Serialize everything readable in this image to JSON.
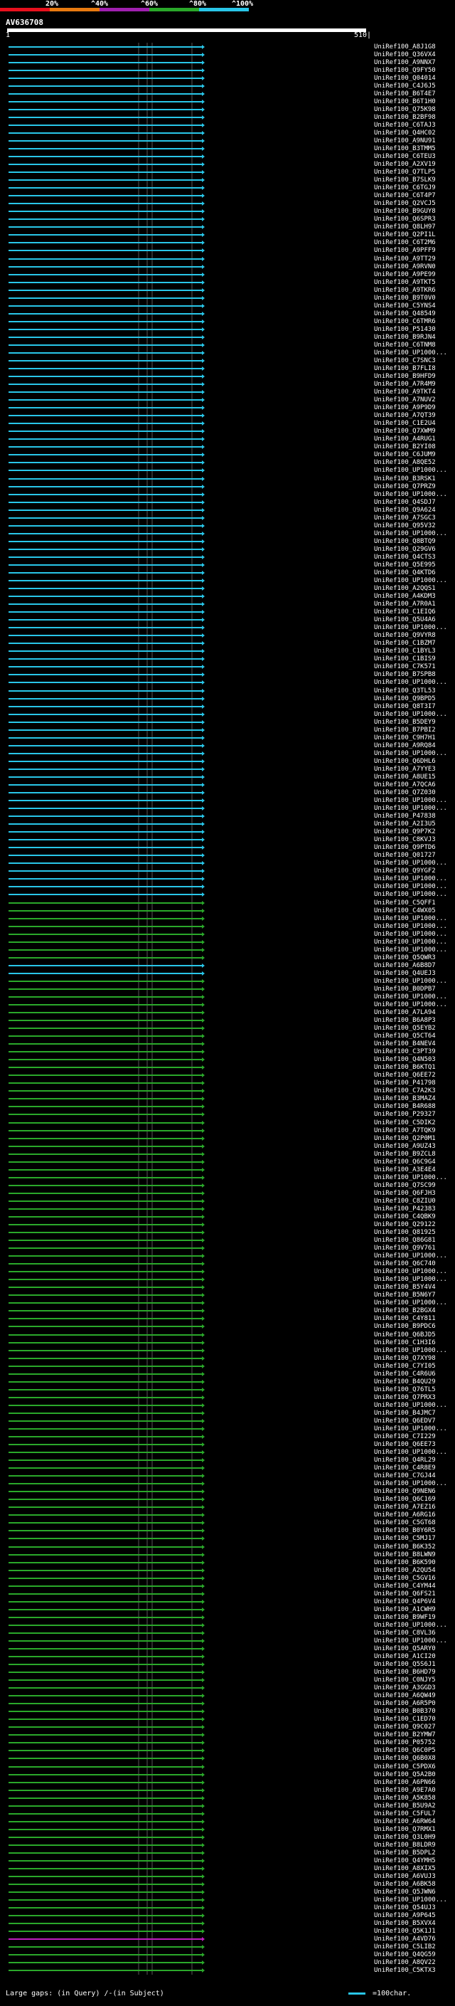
{
  "legend": {
    "ticks": [
      "20%",
      "^40%",
      "^60%",
      "^80%",
      "^100%"
    ],
    "colors": [
      "#e8101d",
      "#e87a10",
      "#a020b0",
      "#2aa82a",
      "#29c6e8"
    ]
  },
  "query": {
    "title": "AV636708",
    "start": "1",
    "end": "510|"
  },
  "colors": {
    "cyan": "#29c6e8",
    "green": "#2aa82a",
    "magenta": "#c020c0",
    "background": "#000000",
    "query_bar": "#ffffff"
  },
  "hits": [
    {
      "label": "UniRef100_A8J1G8",
      "color": "cyan"
    },
    {
      "label": "UniRef100_Q36VX4",
      "color": "cyan"
    },
    {
      "label": "UniRef100_A9NNX7",
      "color": "cyan"
    },
    {
      "label": "UniRef100_Q9FY50",
      "color": "cyan"
    },
    {
      "label": "UniRef100_Q04014",
      "color": "cyan"
    },
    {
      "label": "UniRef100_C4J6J5",
      "color": "cyan"
    },
    {
      "label": "UniRef100_B6T4E7",
      "color": "cyan"
    },
    {
      "label": "UniRef100_B6T1H0",
      "color": "cyan"
    },
    {
      "label": "UniRef100_Q75K98",
      "color": "cyan"
    },
    {
      "label": "UniRef100_B2BF98",
      "color": "cyan"
    },
    {
      "label": "UniRef100_C6TAJ3",
      "color": "cyan"
    },
    {
      "label": "UniRef100_Q4HC02",
      "color": "cyan"
    },
    {
      "label": "UniRef100_A9NU91",
      "color": "cyan"
    },
    {
      "label": "UniRef100_B3TMM5",
      "color": "cyan"
    },
    {
      "label": "UniRef100_C6TEU3",
      "color": "cyan"
    },
    {
      "label": "UniRef100_A2XV19",
      "color": "cyan"
    },
    {
      "label": "UniRef100_Q7TLP5",
      "color": "cyan"
    },
    {
      "label": "UniRef100_B7SLK9",
      "color": "cyan"
    },
    {
      "label": "UniRef100_C6TGJ9",
      "color": "cyan"
    },
    {
      "label": "UniRef100_C6T4P7",
      "color": "cyan"
    },
    {
      "label": "UniRef100_Q2VCJ5",
      "color": "cyan"
    },
    {
      "label": "UniRef100_B9GUY8",
      "color": "cyan"
    },
    {
      "label": "UniRef100_Q6SPR3",
      "color": "cyan"
    },
    {
      "label": "UniRef100_Q8LH97",
      "color": "cyan"
    },
    {
      "label": "UniRef100_Q2PI1L",
      "color": "cyan"
    },
    {
      "label": "UniRef100_C6T2M6",
      "color": "cyan"
    },
    {
      "label": "UniRef100_A9PFF9",
      "color": "cyan"
    },
    {
      "label": "UniRef100_A9TT29",
      "color": "cyan"
    },
    {
      "label": "UniRef100_A9RVN0",
      "color": "cyan"
    },
    {
      "label": "UniRef100_A9PE99",
      "color": "cyan"
    },
    {
      "label": "UniRef100_A9TKT5",
      "color": "cyan"
    },
    {
      "label": "UniRef100_A9TKR6",
      "color": "cyan"
    },
    {
      "label": "UniRef100_B9T0V0",
      "color": "cyan"
    },
    {
      "label": "UniRef100_C5YNS4",
      "color": "cyan"
    },
    {
      "label": "UniRef100_Q48549",
      "color": "cyan"
    },
    {
      "label": "UniRef100_C6TMR6",
      "color": "cyan"
    },
    {
      "label": "UniRef100_P51430",
      "color": "cyan"
    },
    {
      "label": "UniRef100_B9RJN4",
      "color": "cyan"
    },
    {
      "label": "UniRef100_C6TNM8",
      "color": "cyan"
    },
    {
      "label": "UniRef100_UP1000...",
      "color": "cyan"
    },
    {
      "label": "UniRef100_C7SNC3",
      "color": "cyan"
    },
    {
      "label": "UniRef100_B7FLI8",
      "color": "cyan"
    },
    {
      "label": "UniRef100_B9HFD9",
      "color": "cyan"
    },
    {
      "label": "UniRef100_A7R4M9",
      "color": "cyan"
    },
    {
      "label": "UniRef100_A9TKT4",
      "color": "cyan"
    },
    {
      "label": "UniRef100_A7NUV2",
      "color": "cyan"
    },
    {
      "label": "UniRef100_A9P9D9",
      "color": "cyan"
    },
    {
      "label": "UniRef100_A7QT39",
      "color": "cyan"
    },
    {
      "label": "UniRef100_C1E2U4",
      "color": "cyan"
    },
    {
      "label": "UniRef100_Q7XWM9",
      "color": "cyan"
    },
    {
      "label": "UniRef100_A4RUG1",
      "color": "cyan"
    },
    {
      "label": "UniRef100_B2YI08",
      "color": "cyan"
    },
    {
      "label": "UniRef100_C6JUM9",
      "color": "cyan"
    },
    {
      "label": "UniRef100_A8QE52",
      "color": "cyan"
    },
    {
      "label": "UniRef100_UP1000...",
      "color": "cyan"
    },
    {
      "label": "UniRef100_B3RSK1",
      "color": "cyan"
    },
    {
      "label": "UniRef100_Q7PRZ9",
      "color": "cyan"
    },
    {
      "label": "UniRef100_UP1000...",
      "color": "cyan"
    },
    {
      "label": "UniRef100_Q4SDJ7",
      "color": "cyan"
    },
    {
      "label": "UniRef100_Q9A624",
      "color": "cyan"
    },
    {
      "label": "UniRef100_A7SGC3",
      "color": "cyan"
    },
    {
      "label": "UniRef100_Q95V32",
      "color": "cyan"
    },
    {
      "label": "UniRef100_UP1000...",
      "color": "cyan"
    },
    {
      "label": "UniRef100_Q8BTQ9",
      "color": "cyan"
    },
    {
      "label": "UniRef100_Q29GV6",
      "color": "cyan"
    },
    {
      "label": "UniRef100_Q4CTS3",
      "color": "cyan"
    },
    {
      "label": "UniRef100_Q5E995",
      "color": "cyan"
    },
    {
      "label": "UniRef100_Q4KTD6",
      "color": "cyan"
    },
    {
      "label": "UniRef100_UP1000...",
      "color": "cyan"
    },
    {
      "label": "UniRef100_A2QQS1",
      "color": "cyan"
    },
    {
      "label": "UniRef100_A4KDM3",
      "color": "cyan"
    },
    {
      "label": "UniRef100_A7R0A1",
      "color": "cyan"
    },
    {
      "label": "UniRef100_C1EIQ6",
      "color": "cyan"
    },
    {
      "label": "UniRef100_Q5U4A6",
      "color": "cyan"
    },
    {
      "label": "UniRef100_UP1000...",
      "color": "cyan"
    },
    {
      "label": "UniRef100_Q9VYR8",
      "color": "cyan"
    },
    {
      "label": "UniRef100_C1BZM7",
      "color": "cyan"
    },
    {
      "label": "UniRef100_C1BYL3",
      "color": "cyan"
    },
    {
      "label": "UniRef100_C1BIS9",
      "color": "cyan"
    },
    {
      "label": "UniRef100_C7K571",
      "color": "cyan"
    },
    {
      "label": "UniRef100_B7SPB8",
      "color": "cyan"
    },
    {
      "label": "UniRef100_UP1000...",
      "color": "cyan"
    },
    {
      "label": "UniRef100_Q3TL53",
      "color": "cyan"
    },
    {
      "label": "UniRef100_Q9BPD5",
      "color": "cyan"
    },
    {
      "label": "UniRef100_Q8T3I7",
      "color": "cyan"
    },
    {
      "label": "UniRef100_UP1000...",
      "color": "cyan"
    },
    {
      "label": "UniRef100_B5DEY9",
      "color": "cyan"
    },
    {
      "label": "UniRef100_B7PBI2",
      "color": "cyan"
    },
    {
      "label": "UniRef100_C9H7H1",
      "color": "cyan"
    },
    {
      "label": "UniRef100_A9RQ84",
      "color": "cyan"
    },
    {
      "label": "UniRef100_UP1000...",
      "color": "cyan"
    },
    {
      "label": "UniRef100_Q6DHL6",
      "color": "cyan"
    },
    {
      "label": "UniRef100_A7YYE3",
      "color": "cyan"
    },
    {
      "label": "UniRef100_A8UE15",
      "color": "cyan"
    },
    {
      "label": "UniRef100_A7QCA6",
      "color": "cyan"
    },
    {
      "label": "UniRef100_Q7Z030",
      "color": "cyan"
    },
    {
      "label": "UniRef100_UP1000...",
      "color": "cyan"
    },
    {
      "label": "UniRef100_UP1000...",
      "color": "cyan"
    },
    {
      "label": "UniRef100_P47838",
      "color": "cyan"
    },
    {
      "label": "UniRef100_A2I3U5",
      "color": "cyan"
    },
    {
      "label": "UniRef100_Q9P7K2",
      "color": "cyan"
    },
    {
      "label": "UniRef100_C8KVJ3",
      "color": "cyan"
    },
    {
      "label": "UniRef100_Q9PTD6",
      "color": "cyan"
    },
    {
      "label": "UniRef100_Q01727",
      "color": "cyan"
    },
    {
      "label": "UniRef100_UP1000...",
      "color": "cyan"
    },
    {
      "label": "UniRef100_Q9YGF2",
      "color": "cyan"
    },
    {
      "label": "UniRef100_UP1000...",
      "color": "cyan"
    },
    {
      "label": "UniRef100_UP1000...",
      "color": "cyan"
    },
    {
      "label": "UniRef100_UP1000...",
      "color": "cyan"
    },
    {
      "label": "UniRef100_C5QFF1",
      "color": "green"
    },
    {
      "label": "UniRef100_C4WX05",
      "color": "green"
    },
    {
      "label": "UniRef100_UP1000...",
      "color": "green"
    },
    {
      "label": "UniRef100_UP1000...",
      "color": "green"
    },
    {
      "label": "UniRef100_UP1000...",
      "color": "green"
    },
    {
      "label": "UniRef100_UP1000...",
      "color": "green"
    },
    {
      "label": "UniRef100_UP1000...",
      "color": "green"
    },
    {
      "label": "UniRef100_Q5QWR3",
      "color": "green"
    },
    {
      "label": "UniRef100_A6B8D7",
      "color": "cyan"
    },
    {
      "label": "UniRef100_Q4UEJ3",
      "color": "cyan"
    },
    {
      "label": "UniRef100_UP1000...",
      "color": "green"
    },
    {
      "label": "UniRef100_B0DPB7",
      "color": "green"
    },
    {
      "label": "UniRef100_UP1000...",
      "color": "green"
    },
    {
      "label": "UniRef100_UP1000...",
      "color": "green"
    },
    {
      "label": "UniRef100_A7LA94",
      "color": "green"
    },
    {
      "label": "UniRef100_B6A8P3",
      "color": "green"
    },
    {
      "label": "UniRef100_Q5EYB2",
      "color": "green"
    },
    {
      "label": "UniRef100_Q5CT64",
      "color": "green"
    },
    {
      "label": "UniRef100_B4NEV4",
      "color": "green"
    },
    {
      "label": "UniRef100_C3PT39",
      "color": "green"
    },
    {
      "label": "UniRef100_Q4N503",
      "color": "green"
    },
    {
      "label": "UniRef100_B6KTQ1",
      "color": "green"
    },
    {
      "label": "UniRef100_Q6EE72",
      "color": "green"
    },
    {
      "label": "UniRef100_P41798",
      "color": "green"
    },
    {
      "label": "UniRef100_C7A2K3",
      "color": "green"
    },
    {
      "label": "UniRef100_B3MAZ4",
      "color": "green"
    },
    {
      "label": "UniRef100_B4R688",
      "color": "green"
    },
    {
      "label": "UniRef100_P29327",
      "green": true,
      "color": "green"
    },
    {
      "label": "UniRef100_C5DIK2",
      "color": "green"
    },
    {
      "label": "UniRef100_A7TQK9",
      "color": "green"
    },
    {
      "label": "UniRef100_Q2P0M1",
      "color": "green"
    },
    {
      "label": "UniRef100_A9UZ43",
      "color": "green"
    },
    {
      "label": "UniRef100_B9ZCL8",
      "color": "green"
    },
    {
      "label": "UniRef100_Q6C9G4",
      "color": "green"
    },
    {
      "label": "UniRef100_A3E4E4",
      "color": "green"
    },
    {
      "label": "UniRef100_UP1000...",
      "color": "green"
    },
    {
      "label": "UniRef100_Q7SC99",
      "color": "green"
    },
    {
      "label": "UniRef100_Q6FJH3",
      "color": "green"
    },
    {
      "label": "UniRef100_C8ZIU0",
      "color": "green"
    },
    {
      "label": "UniRef100_P42383",
      "color": "green"
    },
    {
      "label": "UniRef100_C4QBK9",
      "color": "green"
    },
    {
      "label": "UniRef100_Q29122",
      "color": "green"
    },
    {
      "label": "UniRef100_Q81925",
      "color": "green"
    },
    {
      "label": "UniRef100_Q86G81",
      "color": "green"
    },
    {
      "label": "UniRef100_Q9V761",
      "color": "green"
    },
    {
      "label": "UniRef100_UP1000...",
      "color": "green"
    },
    {
      "label": "UniRef100_Q6C740",
      "color": "green"
    },
    {
      "label": "UniRef100_UP1000...",
      "color": "green"
    },
    {
      "label": "UniRef100_UP1000...",
      "color": "green"
    },
    {
      "label": "UniRef100_B5Y4V4",
      "color": "green"
    },
    {
      "label": "UniRef100_B5N6Y7",
      "color": "green"
    },
    {
      "label": "UniRef100_UP1000...",
      "color": "green"
    },
    {
      "label": "UniRef100_B2BGX4",
      "color": "green"
    },
    {
      "label": "UniRef100_C4Y811",
      "color": "green"
    },
    {
      "label": "UniRef100_B9PDC6",
      "color": "green"
    },
    {
      "label": "UniRef100_Q6BJD5",
      "color": "green"
    },
    {
      "label": "UniRef100_C1H3I6",
      "color": "green"
    },
    {
      "label": "UniRef100_UP1000...",
      "color": "green"
    },
    {
      "label": "UniRef100_Q7XY98",
      "color": "green"
    },
    {
      "label": "UniRef100_C7YI05",
      "color": "green"
    },
    {
      "label": "UniRef100_C4R6U6",
      "color": "green"
    },
    {
      "label": "UniRef100_B4QU29",
      "color": "green"
    },
    {
      "label": "UniRef100_Q76TL5",
      "color": "green"
    },
    {
      "label": "UniRef100_Q7PRX3",
      "color": "green"
    },
    {
      "label": "UniRef100_UP1000...",
      "color": "green"
    },
    {
      "label": "UniRef100_B4JMC7",
      "color": "green"
    },
    {
      "label": "UniRef100_Q6EDV7",
      "color": "green"
    },
    {
      "label": "UniRef100_UP1000...",
      "color": "green"
    },
    {
      "label": "UniRef100_C7I229",
      "color": "green"
    },
    {
      "label": "UniRef100_Q6EE73",
      "color": "green"
    },
    {
      "label": "UniRef100_UP1000...",
      "color": "green"
    },
    {
      "label": "UniRef100_Q4RL29",
      "color": "green"
    },
    {
      "label": "UniRef100_C4R8E9",
      "color": "green"
    },
    {
      "label": "UniRef100_C7GJ44",
      "color": "green"
    },
    {
      "label": "UniRef100_UP1000...",
      "color": "green"
    },
    {
      "label": "UniRef100_Q9NEN6",
      "color": "green"
    },
    {
      "label": "UniRef100_Q6C169",
      "color": "green"
    },
    {
      "label": "UniRef100_A7EZ16",
      "color": "green"
    },
    {
      "label": "UniRef100_A6RG16",
      "color": "green"
    },
    {
      "label": "UniRef100_C5GT68",
      "color": "green"
    },
    {
      "label": "UniRef100_B0Y6R5",
      "color": "green"
    },
    {
      "label": "UniRef100_C5MJ17",
      "color": "green"
    },
    {
      "label": "UniRef100_B6K352",
      "color": "green"
    },
    {
      "label": "UniRef100_B8LWN9",
      "color": "green"
    },
    {
      "label": "UniRef100_B6K590",
      "color": "green"
    },
    {
      "label": "UniRef100_A2QU54",
      "color": "green"
    },
    {
      "label": "UniRef100_C5GV16",
      "color": "green"
    },
    {
      "label": "UniRef100_C4YM44",
      "color": "green"
    },
    {
      "label": "UniRef100_Q6FS21",
      "color": "green"
    },
    {
      "label": "UniRef100_Q4P6V4",
      "color": "green"
    },
    {
      "label": "UniRef100_A1CWH9",
      "color": "green"
    },
    {
      "label": "UniRef100_B9WF19",
      "color": "green"
    },
    {
      "label": "UniRef100_UP1000...",
      "color": "green"
    },
    {
      "label": "UniRef100_C8VL36",
      "color": "green"
    },
    {
      "label": "UniRef100_UP1000...",
      "color": "green"
    },
    {
      "label": "UniRef100_Q5ARY0",
      "color": "green"
    },
    {
      "label": "UniRef100_A1CI20",
      "color": "green"
    },
    {
      "label": "UniRef100_Q5S6J1",
      "color": "green"
    },
    {
      "label": "UniRef100_B6HD79",
      "color": "green"
    },
    {
      "label": "UniRef100_C0NJY5",
      "color": "green"
    },
    {
      "label": "UniRef100_A3GGD3",
      "color": "green"
    },
    {
      "label": "UniRef100_A6QW49",
      "color": "green"
    },
    {
      "label": "UniRef100_A6R5P0",
      "color": "green"
    },
    {
      "label": "UniRef100_B0B370",
      "color": "green"
    },
    {
      "label": "UniRef100_C1ED70",
      "color": "green"
    },
    {
      "label": "UniRef100_Q9C027",
      "color": "green"
    },
    {
      "label": "UniRef100_B2YMW7",
      "color": "green"
    },
    {
      "label": "UniRef100_P05752",
      "color": "green"
    },
    {
      "label": "UniRef100_Q6C0P5",
      "color": "green"
    },
    {
      "label": "UniRef100_Q6B0X8",
      "color": "green"
    },
    {
      "label": "UniRef100_C5PDX6",
      "color": "green"
    },
    {
      "label": "UniRef100_Q5A2B0",
      "color": "green"
    },
    {
      "label": "UniRef100_A6PN66",
      "color": "green"
    },
    {
      "label": "UniRef100_A9E7A0",
      "color": "green"
    },
    {
      "label": "UniRef100_A5K858",
      "color": "green"
    },
    {
      "label": "UniRef100_B5U9A2",
      "color": "green"
    },
    {
      "label": "UniRef100_C5FUL7",
      "color": "green"
    },
    {
      "label": "UniRef100_A6RW64",
      "color": "green"
    },
    {
      "label": "UniRef100_Q7RMX1",
      "color": "green"
    },
    {
      "label": "UniRef100_Q3L0H9",
      "color": "green"
    },
    {
      "label": "UniRef100_B8LDR9",
      "color": "green"
    },
    {
      "label": "UniRef100_B5DPL2",
      "color": "green"
    },
    {
      "label": "UniRef100_Q4YMH5",
      "color": "green"
    },
    {
      "label": "UniRef100_A8XIX5",
      "color": "green"
    },
    {
      "label": "UniRef100_A6VUJ3",
      "color": "green"
    },
    {
      "label": "UniRef100_A6BK58",
      "color": "green"
    },
    {
      "label": "UniRef100_Q5JWN6",
      "color": "green"
    },
    {
      "label": "UniRef100_UP1000...",
      "color": "green"
    },
    {
      "label": "UniRef100_Q54UJ3",
      "color": "green"
    },
    {
      "label": "UniRef100_A9P645",
      "color": "green"
    },
    {
      "label": "UniRef100_B5XVX4",
      "color": "green"
    },
    {
      "label": "UniRef100_Q5K1J1",
      "color": "green"
    },
    {
      "label": "UniRef100_A4VD76",
      "color": "magenta"
    },
    {
      "label": "UniRef100_C5LIB2",
      "color": "green"
    },
    {
      "label": "UniRef100_Q4QG59",
      "color": "green"
    },
    {
      "label": "UniRef100_A8QV22",
      "color": "green"
    },
    {
      "label": "UniRef100_C5KTX3",
      "color": "green"
    }
  ],
  "footer": {
    "large_gaps": "Large gaps:",
    "in_query": "(in Query)",
    "in_subject": "/-(in Subject)",
    "scale": "=100char."
  }
}
